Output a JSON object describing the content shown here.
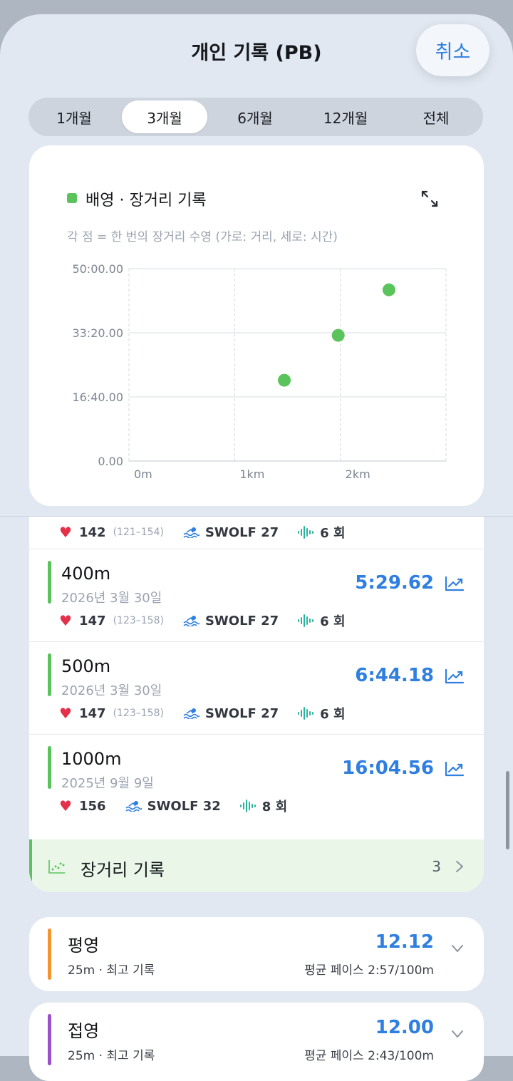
{
  "header": {
    "title": "개인 기록 (PB)",
    "cancel_label": "취소"
  },
  "segments": [
    {
      "label": "1개월",
      "active": false
    },
    {
      "label": "3개월",
      "active": true
    },
    {
      "label": "6개월",
      "active": false
    },
    {
      "label": "12개월",
      "active": false
    },
    {
      "label": "전체",
      "active": false
    }
  ],
  "chart_card": {
    "legend": "배영 · 장거리 기록",
    "subtitle": "각 점 = 한 번의 장거리 수영 (가로: 거리, 세로: 시간)",
    "expand_icon": "expand-arrows-icon"
  },
  "chart_data": {
    "type": "scatter",
    "title": "",
    "xlabel": "",
    "ylabel": "",
    "x_ticks": [
      "0m",
      "1km",
      "2km"
    ],
    "y_ticks": [
      "0.00",
      "16:40.00",
      "33:20.00",
      "50:00.00"
    ],
    "xlim_m": [
      0,
      3000
    ],
    "ylim_s": [
      0,
      3000
    ],
    "grid": true,
    "color": "#5ac35b",
    "series": [
      {
        "points": [
          {
            "x_m": 1470,
            "y_s": 1260
          },
          {
            "x_m": 1980,
            "y_s": 1960
          },
          {
            "x_m": 2460,
            "y_s": 2670
          }
        ]
      }
    ]
  },
  "records": {
    "partial": {
      "hr": "142",
      "range": "(121–154)",
      "swolf": "SWOLF 27",
      "laps": "6 회"
    },
    "items": [
      {
        "distance": "400m",
        "date": "2026년 3월 30일",
        "time": "5:29.62",
        "hr": "147",
        "range": "(123–158)",
        "swolf": "SWOLF 27",
        "laps": "6 회"
      },
      {
        "distance": "500m",
        "date": "2026년 3월 30일",
        "time": "6:44.18",
        "hr": "147",
        "range": "(123–158)",
        "swolf": "SWOLF 27",
        "laps": "6 회"
      },
      {
        "distance": "1000m",
        "date": "2025년 9월 9일",
        "time": "16:04.56",
        "hr": "156",
        "range": "",
        "swolf": "SWOLF 32",
        "laps": "8 회"
      }
    ],
    "long_distance": {
      "label": "장거리 기록",
      "count": "3"
    }
  },
  "strokes": [
    {
      "name": "평영",
      "sub": "25m · 최고 기록",
      "value": "12.12",
      "pace": "평균 페이스 2:57/100m",
      "color": "#f3952f"
    },
    {
      "name": "접영",
      "sub": "25m · 최고 기록",
      "value": "12.00",
      "pace": "평균 페이스 2:43/100m",
      "color": "#9b51c9"
    }
  ],
  "colors": {
    "accent": "#2f7fe0",
    "green": "#5ac35b",
    "heart": "#e5304a",
    "wave": "#2bb3a0"
  }
}
